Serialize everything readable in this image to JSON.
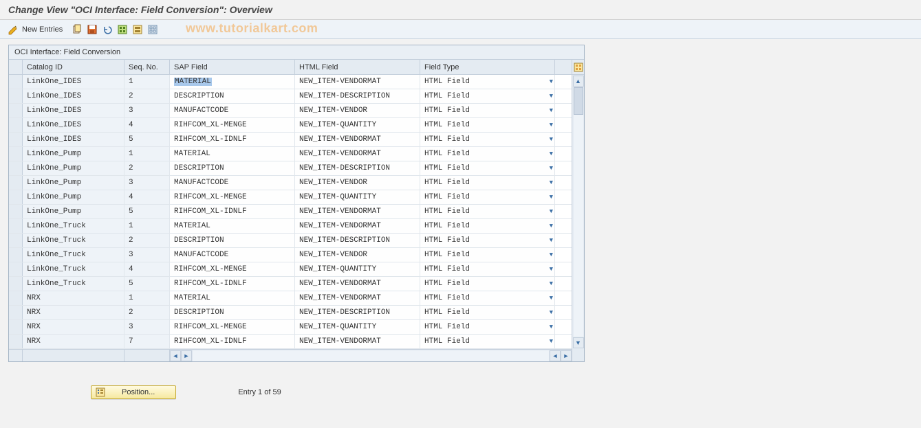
{
  "title": "Change View \"OCI Interface: Field Conversion\": Overview",
  "toolbar": {
    "new_entries": "New Entries"
  },
  "watermark": "www.tutorialkart.com",
  "table": {
    "title": "OCI Interface: Field Conversion",
    "columns": {
      "catalog": "Catalog ID",
      "seq": "Seq. No.",
      "sap": "SAP Field",
      "html": "HTML Field",
      "ftype": "Field Type"
    },
    "rows": [
      {
        "catalog": "LinkOne_IDES",
        "seq": "1",
        "sap": "MATERIAL",
        "html": "NEW_ITEM-VENDORMAT",
        "ftype": "HTML Field",
        "highlight_sap": true
      },
      {
        "catalog": "LinkOne_IDES",
        "seq": "2",
        "sap": "DESCRIPTION",
        "html": "NEW_ITEM-DESCRIPTION",
        "ftype": "HTML Field"
      },
      {
        "catalog": "LinkOne_IDES",
        "seq": "3",
        "sap": "MANUFACTCODE",
        "html": "NEW_ITEM-VENDOR",
        "ftype": "HTML Field"
      },
      {
        "catalog": "LinkOne_IDES",
        "seq": "4",
        "sap": "RIHFCOM_XL-MENGE",
        "html": "NEW_ITEM-QUANTITY",
        "ftype": "HTML Field"
      },
      {
        "catalog": "LinkOne_IDES",
        "seq": "5",
        "sap": "RIHFCOM_XL-IDNLF",
        "html": "NEW_ITEM-VENDORMAT",
        "ftype": "HTML Field"
      },
      {
        "catalog": "LinkOne_Pump",
        "seq": "1",
        "sap": "MATERIAL",
        "html": "NEW_ITEM-VENDORMAT",
        "ftype": "HTML Field"
      },
      {
        "catalog": "LinkOne_Pump",
        "seq": "2",
        "sap": "DESCRIPTION",
        "html": "NEW_ITEM-DESCRIPTION",
        "ftype": "HTML Field"
      },
      {
        "catalog": "LinkOne_Pump",
        "seq": "3",
        "sap": "MANUFACTCODE",
        "html": "NEW_ITEM-VENDOR",
        "ftype": "HTML Field"
      },
      {
        "catalog": "LinkOne_Pump",
        "seq": "4",
        "sap": "RIHFCOM_XL-MENGE",
        "html": "NEW_ITEM-QUANTITY",
        "ftype": "HTML Field"
      },
      {
        "catalog": "LinkOne_Pump",
        "seq": "5",
        "sap": "RIHFCOM_XL-IDNLF",
        "html": "NEW_ITEM-VENDORMAT",
        "ftype": "HTML Field"
      },
      {
        "catalog": "LinkOne_Truck",
        "seq": "1",
        "sap": "MATERIAL",
        "html": "NEW_ITEM-VENDORMAT",
        "ftype": "HTML Field"
      },
      {
        "catalog": "LinkOne_Truck",
        "seq": "2",
        "sap": "DESCRIPTION",
        "html": "NEW_ITEM-DESCRIPTION",
        "ftype": "HTML Field"
      },
      {
        "catalog": "LinkOne_Truck",
        "seq": "3",
        "sap": "MANUFACTCODE",
        "html": "NEW_ITEM-VENDOR",
        "ftype": "HTML Field"
      },
      {
        "catalog": "LinkOne_Truck",
        "seq": "4",
        "sap": "RIHFCOM_XL-MENGE",
        "html": "NEW_ITEM-QUANTITY",
        "ftype": "HTML Field"
      },
      {
        "catalog": "LinkOne_Truck",
        "seq": "5",
        "sap": "RIHFCOM_XL-IDNLF",
        "html": "NEW_ITEM-VENDORMAT",
        "ftype": "HTML Field"
      },
      {
        "catalog": "NRX",
        "seq": "1",
        "sap": "MATERIAL",
        "html": "NEW_ITEM-VENDORMAT",
        "ftype": "HTML Field"
      },
      {
        "catalog": "NRX",
        "seq": "2",
        "sap": "DESCRIPTION",
        "html": "NEW_ITEM-DESCRIPTION",
        "ftype": "HTML Field"
      },
      {
        "catalog": "NRX",
        "seq": "3",
        "sap": "RIHFCOM_XL-MENGE",
        "html": "NEW_ITEM-QUANTITY",
        "ftype": "HTML Field"
      },
      {
        "catalog": "NRX",
        "seq": "7",
        "sap": "RIHFCOM_XL-IDNLF",
        "html": "NEW_ITEM-VENDORMAT",
        "ftype": "HTML Field"
      }
    ]
  },
  "footer": {
    "position_label": "Position...",
    "entry_text": "Entry 1 of 59"
  }
}
